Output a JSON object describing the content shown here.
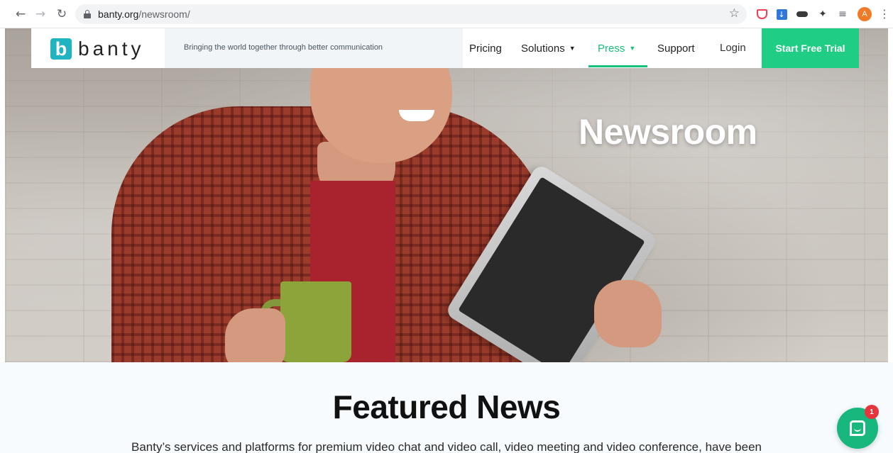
{
  "browser": {
    "url_host": "banty.org",
    "url_path": "/newsroom/",
    "avatar_initial": "A"
  },
  "header": {
    "logo_letter": "b",
    "logo_text": "banty",
    "tagline": "Bringing the world together through better communication",
    "nav": {
      "pricing": "Pricing",
      "solutions": "Solutions",
      "press": "Press",
      "support": "Support"
    },
    "login": "Login",
    "cta": "Start Free Trial",
    "active_color": "#19c07a",
    "cta_color": "#1fcd85"
  },
  "hero": {
    "title": "Newsroom"
  },
  "featured": {
    "title": "Featured News",
    "description": "Banty’s services and platforms for premium video chat and video call, video meeting and video conference, have been"
  },
  "chat": {
    "badge_count": "1"
  }
}
